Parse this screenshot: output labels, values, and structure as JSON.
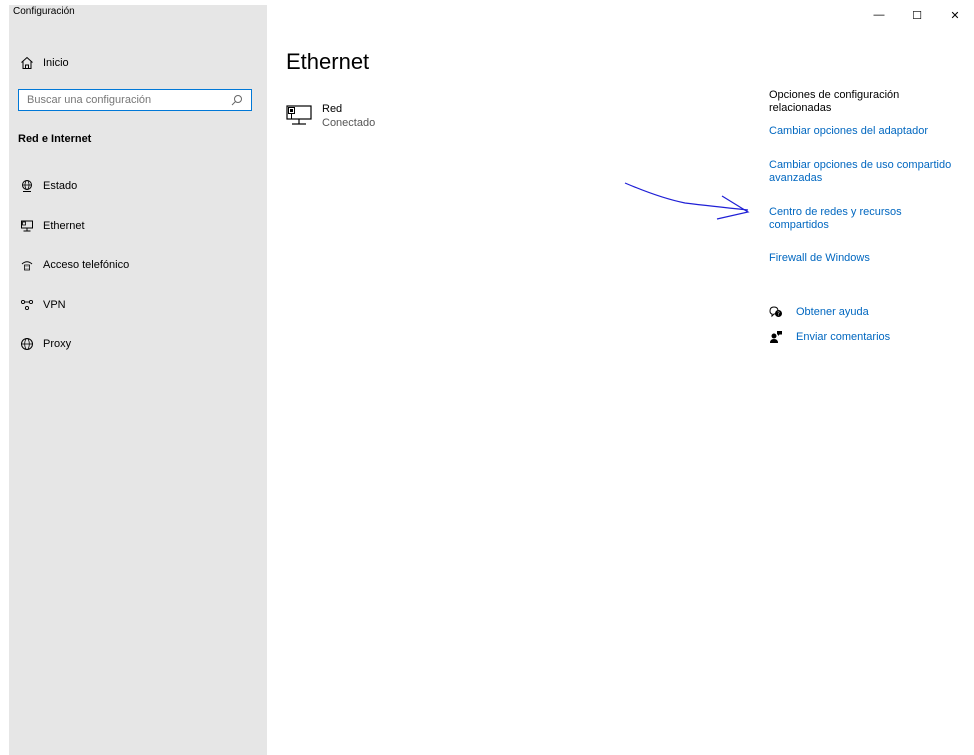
{
  "window": {
    "title": "Configuración",
    "minimize_glyph": "—",
    "maximize_glyph": "☐",
    "close_glyph": "✕"
  },
  "sidebar": {
    "home_label": "Inicio",
    "search_placeholder": "Buscar una configuración",
    "section_title": "Red e Internet",
    "items": [
      {
        "label": "Estado",
        "icon": "globe-status-icon"
      },
      {
        "label": "Ethernet",
        "icon": "ethernet-icon"
      },
      {
        "label": "Acceso telefónico",
        "icon": "dialup-icon"
      },
      {
        "label": "VPN",
        "icon": "vpn-icon"
      },
      {
        "label": "Proxy",
        "icon": "globe-icon"
      }
    ]
  },
  "main": {
    "title": "Ethernet",
    "network": {
      "name": "Red",
      "status": "Conectado",
      "icon": "network-pc-icon"
    }
  },
  "related": {
    "title": "Opciones de configuración relacionadas",
    "links": [
      "Cambiar opciones del adaptador",
      "Cambiar opciones de uso compartido avanzadas",
      "Centro de redes y recursos compartidos",
      "Firewall de Windows"
    ],
    "help_label": "Obtener ayuda",
    "feedback_label": "Enviar comentarios"
  },
  "colors": {
    "accent": "#0078d7",
    "link": "#0067c0",
    "sidebar_bg": "#e6e6e6",
    "annotation": "#1f1fd6"
  }
}
